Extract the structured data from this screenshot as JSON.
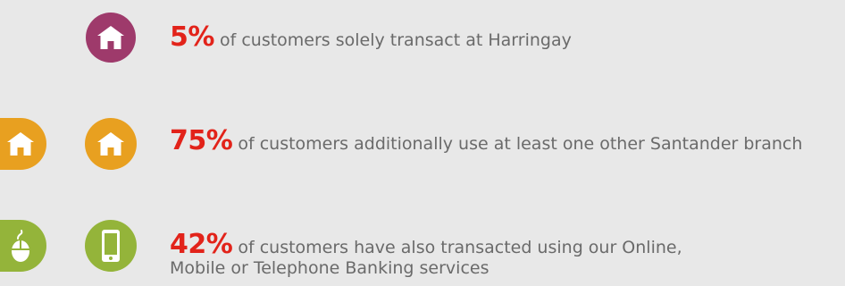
{
  "colors": {
    "background": "#e8e8e8",
    "percent_red": "#e2231a",
    "branch_purple": "#9e3a6b",
    "branch_orange": "#e8a020",
    "digital_green": "#94b43a",
    "text_grey": "#6a6a6a"
  },
  "rows": [
    {
      "icons": [
        "house-icon"
      ],
      "percent": "5%",
      "text": " of customers solely transact at Harringay"
    },
    {
      "icons": [
        "house-icon",
        "house-icon"
      ],
      "percent": "75%",
      "text": " of customers additionally use at least one other Santander branch"
    },
    {
      "icons": [
        "mouse-icon",
        "mobile-phone-icon"
      ],
      "percent": "42%",
      "text": " of customers have also transacted using our Online,",
      "text_line2": "Mobile or Telephone Banking services"
    }
  ]
}
